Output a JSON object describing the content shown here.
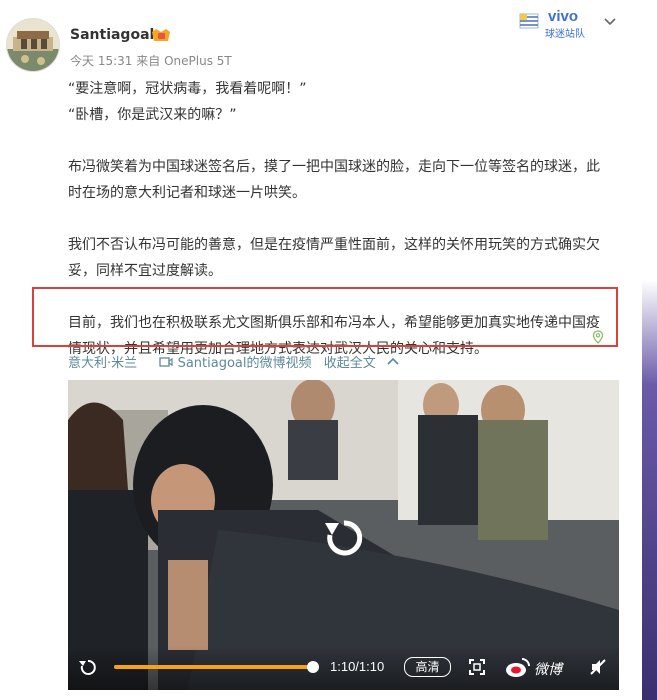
{
  "user": {
    "name": "Santiagoal",
    "meta_time": "今天 15:31",
    "meta_from": "来自",
    "meta_device": "OnePlus 5T"
  },
  "fanclub_badge": {
    "brand": "vivo",
    "label": "球迷站队"
  },
  "post": {
    "paragraphs": [
      "“要注意啊，冠状病毒，我看着呢啊！”",
      "“卧槽，你是武汉来的嘛？”",
      "",
      "布冯微笑着为中国球迷签名后，摸了一把中国球迷的脸，走向下一位等签名的球迷，此时在场的意大利记者和球迷一片哄笑。",
      "",
      "我们不否认布冯可能的善意，但是在疫情严重性面前，这样的关怀用玩笑的方式确实欠妥，同样不宜过度解读。",
      "",
      "目前，我们也在积极联系尤文图斯俱乐部和布冯本人，希望能够更加真实地传递中国疫情现状，并且希望用更加合理地方式表达对武汉人民的关心和支持。"
    ]
  },
  "tags": {
    "location": "意大利·米兰",
    "video_source": "Santiagoal的微博视频",
    "collapse": "收起全文"
  },
  "video": {
    "progress": 1.0,
    "time": "1:10/1:10",
    "quality": "高清",
    "watermark": "微博"
  },
  "colors": {
    "highlight_border": "#d9413b",
    "link": "#5d8a9a",
    "progress": "#f7a21b"
  }
}
